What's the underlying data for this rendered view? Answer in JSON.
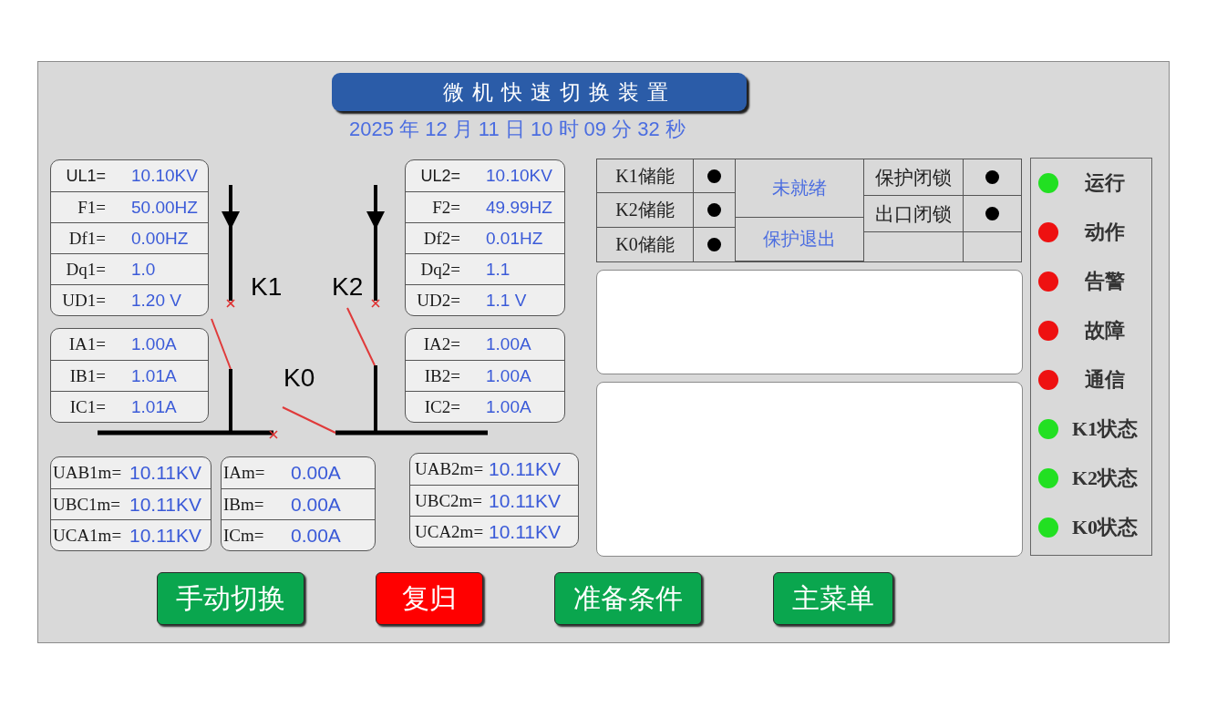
{
  "header": {
    "title": "微机快速切换装置",
    "datetime": "2025 年 12 月 11 日 10 时 09 分 32 秒"
  },
  "left_panels": [
    {
      "rows": [
        {
          "label": "UL1=",
          "value": "10.10KV"
        },
        {
          "label": "F1=",
          "value": "50.00HZ"
        },
        {
          "label": "Df1=",
          "value": "0.00HZ"
        },
        {
          "label": "Dq1=",
          "value": "1.0"
        },
        {
          "label": "UD1=",
          "value": "1.20 V"
        }
      ]
    },
    {
      "rows": [
        {
          "label": "IA1=",
          "value": "1.00A"
        },
        {
          "label": "IB1=",
          "value": "1.01A"
        },
        {
          "label": "IC1=",
          "value": "1.01A"
        }
      ]
    }
  ],
  "diagram": {
    "switches": [
      {
        "label": "K1",
        "closed": false
      },
      {
        "label": "K2",
        "closed": false
      },
      {
        "label": "K0",
        "closed": false
      }
    ]
  },
  "right_panels": [
    {
      "rows": [
        {
          "label": "UL2=",
          "value": "10.10KV"
        },
        {
          "label": "F2=",
          "value": "49.99HZ"
        },
        {
          "label": "Df2=",
          "value": "0.01HZ"
        },
        {
          "label": "Dq2=",
          "value": "1.1"
        },
        {
          "label": "UD2=",
          "value": "1.1 V"
        }
      ]
    },
    {
      "rows": [
        {
          "label": "IA2=",
          "value": "1.00A"
        },
        {
          "label": "IB2=",
          "value": "1.00A"
        },
        {
          "label": "IC2=",
          "value": "1.00A"
        }
      ]
    }
  ],
  "bottom_panels": [
    {
      "rows": [
        {
          "label": "UAB1m=",
          "value": "10.11KV"
        },
        {
          "label": "UBC1m=",
          "value": "10.11KV"
        },
        {
          "label": "UCA1m=",
          "value": "10.11KV"
        }
      ]
    },
    {
      "rows": [
        {
          "label": "IAm=",
          "value": "0.00A"
        },
        {
          "label": "IBm=",
          "value": "0.00A"
        },
        {
          "label": "ICm=",
          "value": "0.00A"
        }
      ]
    },
    {
      "rows": [
        {
          "label": "UAB2m=",
          "value": "10.11KV"
        },
        {
          "label": "UBC2m=",
          "value": "10.11KV"
        },
        {
          "label": "UCA2m=",
          "value": "10.11KV"
        }
      ]
    }
  ],
  "status_table": {
    "storage": [
      {
        "label": "K1储能"
      },
      {
        "label": "K2储能"
      },
      {
        "label": "K0储能"
      }
    ],
    "readiness": "未就绪",
    "protection": "保护退出",
    "locks": [
      {
        "label": "保护闭锁"
      },
      {
        "label": "出口闭锁"
      }
    ]
  },
  "indicators": [
    {
      "label": "运行",
      "color": "#22e022"
    },
    {
      "label": "动作",
      "color": "#ee1111"
    },
    {
      "label": "告警",
      "color": "#ee1111"
    },
    {
      "label": "故障",
      "color": "#ee1111"
    },
    {
      "label": "通信",
      "color": "#ee1111"
    },
    {
      "label": "K1状态",
      "color": "#22e022"
    },
    {
      "label": "K2状态",
      "color": "#22e022"
    },
    {
      "label": "K0状态",
      "color": "#22e022"
    }
  ],
  "buttons": [
    {
      "label": "手动切换",
      "color": "#0aa64e"
    },
    {
      "label": "复归",
      "color": "#ff0000"
    },
    {
      "label": "准备条件",
      "color": "#0aa64e"
    },
    {
      "label": "主菜单",
      "color": "#0aa64e"
    }
  ]
}
